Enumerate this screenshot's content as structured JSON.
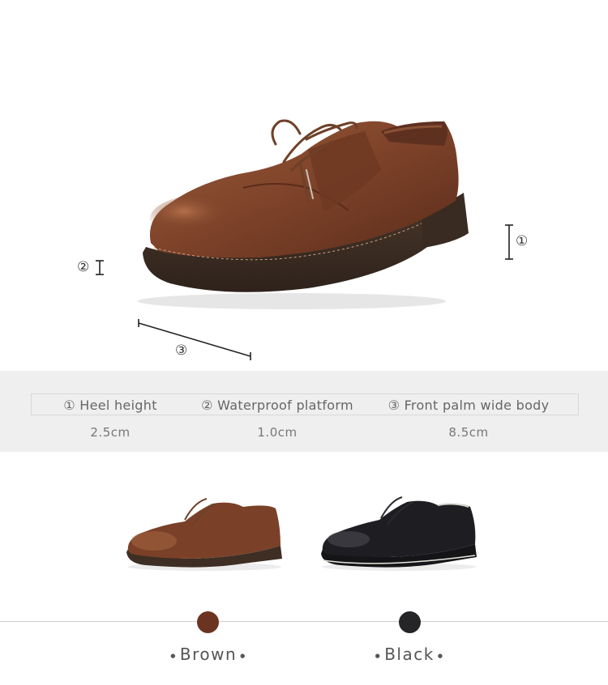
{
  "markers": {
    "m1": "①",
    "m2": "②",
    "m3": "③"
  },
  "specs": [
    {
      "label": "① Heel height",
      "value": "2.5cm"
    },
    {
      "label": "② Waterproof platform",
      "value": "1.0cm"
    },
    {
      "label": "③ Front palm wide body",
      "value": "8.5cm"
    }
  ],
  "colors": [
    {
      "name": "Brown",
      "swatch": "#6b3420"
    },
    {
      "name": "Black",
      "swatch": "#252528"
    }
  ],
  "palette": {
    "brown_leather": "#7a4028",
    "brown_sole": "#3e2e24",
    "black_leather": "#151518",
    "spec_band": "#efefef"
  }
}
